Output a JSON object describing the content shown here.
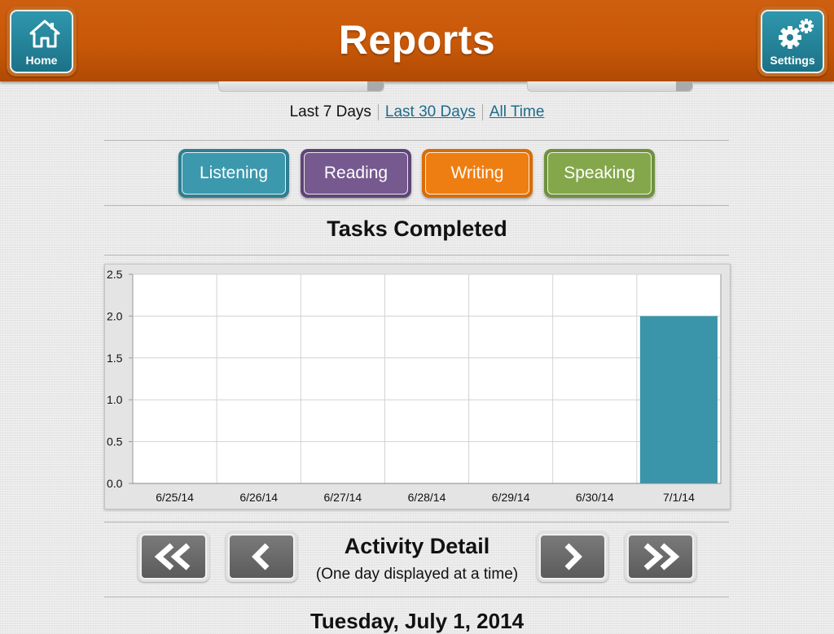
{
  "header": {
    "title": "Reports",
    "home_label": "Home",
    "settings_label": "Settings",
    "home_icon": "house-icon",
    "settings_icon": "gears-icon"
  },
  "range": {
    "selected": "Last 7 Days",
    "options": [
      "Last 7 Days",
      "Last 30 Days",
      "All Time"
    ]
  },
  "skills": [
    {
      "label": "Listening",
      "color": "#3b98ad",
      "outer": "#2f7e91"
    },
    {
      "label": "Reading",
      "color": "#76598f",
      "outer": "#5e4577"
    },
    {
      "label": "Writing",
      "color": "#ef7e12",
      "outer": "#d96c08"
    },
    {
      "label": "Speaking",
      "color": "#84a74c",
      "outer": "#6f913d"
    }
  ],
  "tasks_title": "Tasks Completed",
  "chart_data": {
    "type": "bar",
    "title": "Tasks Completed",
    "categories": [
      "6/25/14",
      "6/26/14",
      "6/27/14",
      "6/28/14",
      "6/29/14",
      "6/30/14",
      "7/1/14"
    ],
    "values": [
      0,
      0,
      0,
      0,
      0,
      0,
      2.0
    ],
    "ylim": [
      0,
      2.5
    ],
    "yticks": [
      "0.0",
      "0.5",
      "1.0",
      "1.5",
      "2.0",
      "2.5"
    ],
    "grid": true,
    "bar_color": "#3a95aa"
  },
  "activity": {
    "title": "Activity Detail",
    "subtitle": "(One day displayed at a time)"
  },
  "current_date": "Tuesday, July 1, 2014"
}
